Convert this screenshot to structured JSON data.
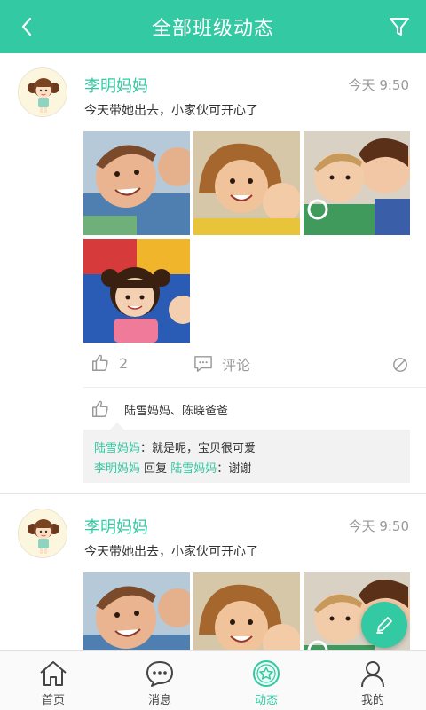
{
  "header": {
    "title": "全部班级动态",
    "back_icon": "chevron-left-icon",
    "filter_icon": "filter-icon"
  },
  "colors": {
    "accent": "#33c9a3",
    "text": "#333333",
    "muted": "#999999"
  },
  "posts": [
    {
      "author": "李明妈妈",
      "time": "今天 9:50",
      "text": "今天带她出去，小家伙可开心了",
      "like_count": "2",
      "comment_label": "评论",
      "liked_by": "陆雪妈妈、陈晓爸爸",
      "comments": [
        {
          "name": "陆雪妈妈",
          "sep": "：",
          "text": "就是呢，宝贝很可爱"
        },
        {
          "name": "李明妈妈",
          "reply_word": " 回复 ",
          "reply_to": "陆雪妈妈",
          "sep": "：",
          "text": "谢谢"
        }
      ]
    },
    {
      "author": "李明妈妈",
      "time": "今天 9:50",
      "text": "今天带她出去，小家伙可开心了"
    }
  ],
  "bottom_nav": [
    {
      "label": "首页",
      "icon": "home-icon"
    },
    {
      "label": "消息",
      "icon": "message-icon"
    },
    {
      "label": "动态",
      "icon": "feed-icon",
      "active": true
    },
    {
      "label": "我的",
      "icon": "profile-icon"
    }
  ],
  "fab_icon": "edit-pen-icon"
}
